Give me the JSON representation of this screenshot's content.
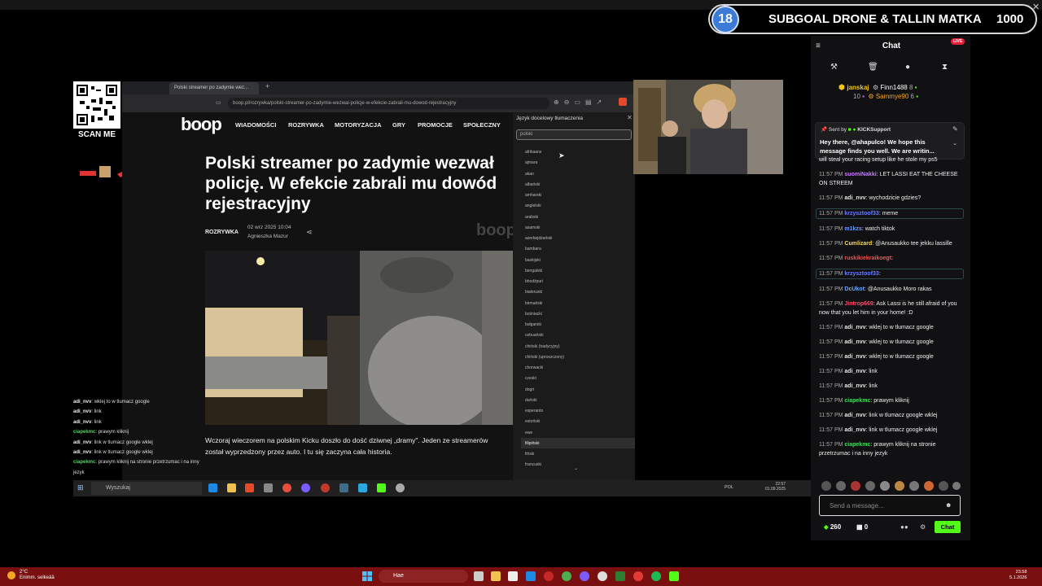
{
  "overlay": {
    "subgoal": {
      "badge": "18",
      "title": "SUBGOAL DRONE & TALLIN MATKA",
      "target": "1000"
    },
    "qr_label": "SCAN ME"
  },
  "browser": {
    "tab_title": "Polski streamer po zadymie wez...",
    "url": "boop.pl/rozrywka/polski-streamer-po-zadymie-wezwal-policje-w-efekcie-zabrali-mu-dowod-rejestracyjny",
    "site_logo": "boop",
    "nav": [
      "WIADOMOŚCI",
      "ROZRYWKA",
      "MOTORYZACJA",
      "GRY",
      "PROMOCJE",
      "SPOŁECZNY"
    ],
    "headline": "Polski streamer po zadymie wezwał policję. W efekcie zabrali mu dowód rejestracyjny",
    "category": "ROZRYWKA",
    "date": "02 wrz 2025 10:04",
    "author": "Agnieszka Mazur",
    "watermark": "boop",
    "lead": "Wczoraj wieczorem na polskim Kicku doszło do dość dziwnej „dramy\". Jeden ze streamerów został wyprzedzony przez auto. I tu się zaczyna cała historia.",
    "translate": {
      "title": "Język docelowy tłumaczenia",
      "input": "polski",
      "languages": [
        "afrikaans",
        "ajmara",
        "akan",
        "albański",
        "amharski",
        "angielski",
        "arabski",
        "asamski",
        "azerbejdżański",
        "bambara",
        "baskijski",
        "bengalski",
        "bhodźpuri",
        "białoruski",
        "birmański",
        "bośniacki",
        "bułgarski",
        "cebuański",
        "chiński (tradycyjny)",
        "chiński (uproszczony)",
        "chorwacki",
        "czeski",
        "dogri",
        "duński",
        "esperanto",
        "estoński",
        "ewe",
        "filipiński",
        "fiński",
        "francuski"
      ],
      "selected_index": 27
    }
  },
  "left_chat": [
    {
      "user": "adi_nvv",
      "text": "wklej to w tlumacz google",
      "green": false
    },
    {
      "user": "adi_nvv",
      "text": "link",
      "green": false
    },
    {
      "user": "adi_nvv",
      "text": "link",
      "green": false
    },
    {
      "user": "ciapekmc",
      "text": "prawym kliknij",
      "green": true
    },
    {
      "user": "adi_nvv",
      "text": "link w tlumacz google wklej",
      "green": false
    },
    {
      "user": "adi_nvv",
      "text": "link w tlumacz google wklej",
      "green": false
    },
    {
      "user": "ciapekmc",
      "text": "prawym kliknij na stronie przetrzumac i na inny",
      "green": true
    },
    {
      "user": "",
      "text": "jezyk",
      "green": false
    }
  ],
  "inner_taskbar": {
    "search": "Wyszukaj",
    "tray": "POL",
    "time": "22:57",
    "date": "01.09.2025"
  },
  "chat": {
    "title": "Chat",
    "live": "LIVE",
    "leaderboard": [
      {
        "a": "janskaj",
        "an": "10",
        "b": "Finn1488",
        "bn": "8"
      },
      {
        "a": "",
        "an": "",
        "b": "Sammye90",
        "bn": "6"
      }
    ],
    "pinned": {
      "from": "Sent by",
      "sender": "KICKSupport",
      "text": "Hey there, @ahapulco! We hope this message finds you well. We are writin..."
    },
    "messages": [
      {
        "time": "",
        "user": "",
        "color": "#e6e6e6",
        "text": "will steal your racing setup like he stole my ps5",
        "hl": false
      },
      {
        "time": "11:57 PM",
        "user": "suomiNakki",
        "color": "#c47cff",
        "text": "LET LASSI EAT THE CHEESE ON STREEM",
        "hl": false
      },
      {
        "time": "11:57 PM",
        "user": "adi_nvv",
        "color": "#e6e6e6",
        "text": "wychodzicie gdzies?",
        "hl": false
      },
      {
        "time": "11:57 PM",
        "user": "krzysztoof33",
        "color": "#6a7cff",
        "text": "meme",
        "hl": true
      },
      {
        "time": "11:57 PM",
        "user": "m1kzs",
        "color": "#6a9cff",
        "text": "watch tiktok",
        "hl": false
      },
      {
        "time": "11:57 PM",
        "user": "Cumlizard",
        "color": "#ffd84d",
        "text": "@Anusaukko tee jekku lassille",
        "hl": false
      },
      {
        "time": "11:57 PM",
        "user": "ruskikiekraikoegt",
        "color": "#ff4d4d",
        "text": "",
        "hl": false
      },
      {
        "time": "11:57 PM",
        "user": "krzysztoof33",
        "color": "#6a7cff",
        "text": "",
        "hl": true
      },
      {
        "time": "11:57 PM",
        "user": "DcUkot",
        "color": "#6aa8ff",
        "text": "@Anusaukko Moro rakas",
        "hl": false
      },
      {
        "time": "11:57 PM",
        "user": "Jintrop669",
        "color": "#ff4d6a",
        "text": "Ask Lassi is he still afraid of you now that you let him in your home! :D",
        "hl": false
      },
      {
        "time": "11:57 PM",
        "user": "adi_nvv",
        "color": "#e6e6e6",
        "text": "wklej to w tlumacz google",
        "hl": false
      },
      {
        "time": "11:57 PM",
        "user": "adi_nvv",
        "color": "#e6e6e6",
        "text": "wklej to w tlumacz google",
        "hl": false
      },
      {
        "time": "11:57 PM",
        "user": "adi_nvv",
        "color": "#e6e6e6",
        "text": "wklej to w tlumacz google",
        "hl": false
      },
      {
        "time": "11:57 PM",
        "user": "adi_nvv",
        "color": "#e6e6e6",
        "text": "link",
        "hl": false
      },
      {
        "time": "11:57 PM",
        "user": "adi_nvv",
        "color": "#e6e6e6",
        "text": "link",
        "hl": false
      },
      {
        "time": "11:57 PM",
        "user": "ciapekmc",
        "color": "#4cd964",
        "text": "prawym kliknij",
        "hl": false
      },
      {
        "time": "11:57 PM",
        "user": "adi_nvv",
        "color": "#e6e6e6",
        "text": "link w tlumacz google wklej",
        "hl": false
      },
      {
        "time": "11:57 PM",
        "user": "adi_nvv",
        "color": "#e6e6e6",
        "text": "link w tlumacz google wklej",
        "hl": false
      },
      {
        "time": "11:57 PM",
        "user": "ciapekmc",
        "color": "#4cd964",
        "text": "prawym kliknij na stronie przetrzumac i na inny jezyk",
        "hl": false
      }
    ],
    "input_placeholder": "Send a message...",
    "points": "260",
    "gifts": "0",
    "send_label": "Chat"
  },
  "outer_taskbar": {
    "temp": "2°C",
    "weather": "Enimm. selkeää",
    "search": "Hae",
    "time": "23.58",
    "date": "5.1.2026"
  }
}
